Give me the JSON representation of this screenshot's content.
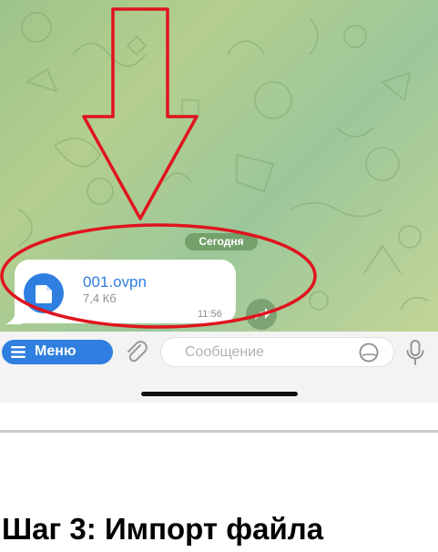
{
  "chat": {
    "date_badge": "Сегодня",
    "message": {
      "file_name": "001.ovpn",
      "file_size": "7,4 Кб",
      "time": "11:56"
    }
  },
  "input_bar": {
    "menu_label": "Меню",
    "message_placeholder": "Сообщение"
  },
  "instruction": {
    "title": "Шаг 3: Импорт файла"
  },
  "colors": {
    "accent": "#2f7fe0",
    "annotation": "#e0141e"
  }
}
